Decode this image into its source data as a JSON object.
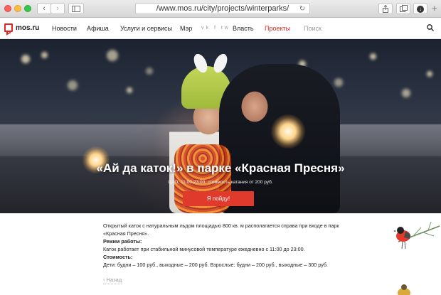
{
  "browser": {
    "url": "/www.mos.ru/city/projects/winterparks/",
    "back_glyph": "‹",
    "forward_glyph": "›",
    "reload_glyph": "↻",
    "new_tab_glyph": "+",
    "download_glyph": "↓"
  },
  "header": {
    "logo_text": "mos.ru",
    "menu": [
      "Новости",
      "Афиша",
      "Услуги и сервисы",
      "Мэр",
      "Власть",
      "Проекты",
      "Поиск"
    ],
    "social": "vk f tw",
    "active_item": "Проекты"
  },
  "hero": {
    "title": "«Ай да каток!» в парке «Красная Пресня»",
    "subtitle": "ЦАО, 11:00-23:00, стоимость катания от 200 руб.",
    "cta_label": "Я пойду!"
  },
  "content": {
    "intro": "Открытый каток с натуральным льдом площадью 800 кв. м располагается справа при входе в парк «Красная Пресня».",
    "hours_heading": "Режим работы:",
    "hours_text": "Каток работает при стабильной минусовой температуре ежедневно с 11:00 до 23:00.",
    "price_heading": "Стоимость:",
    "price_text": "Дети: будни – 100 руб., выходные – 200 руб. Взрослые: будни – 200 руб., выходные – 300 руб.",
    "back_label": "‹ Назад"
  },
  "colors": {
    "accent": "#e5261f",
    "cta": "#e03a2c"
  },
  "icons": {
    "search": "search-icon",
    "share": "share-icon",
    "tabs": "tabs-icon",
    "download": "download-icon",
    "sidebar": "sidebar-icon",
    "reload": "reload-icon"
  }
}
